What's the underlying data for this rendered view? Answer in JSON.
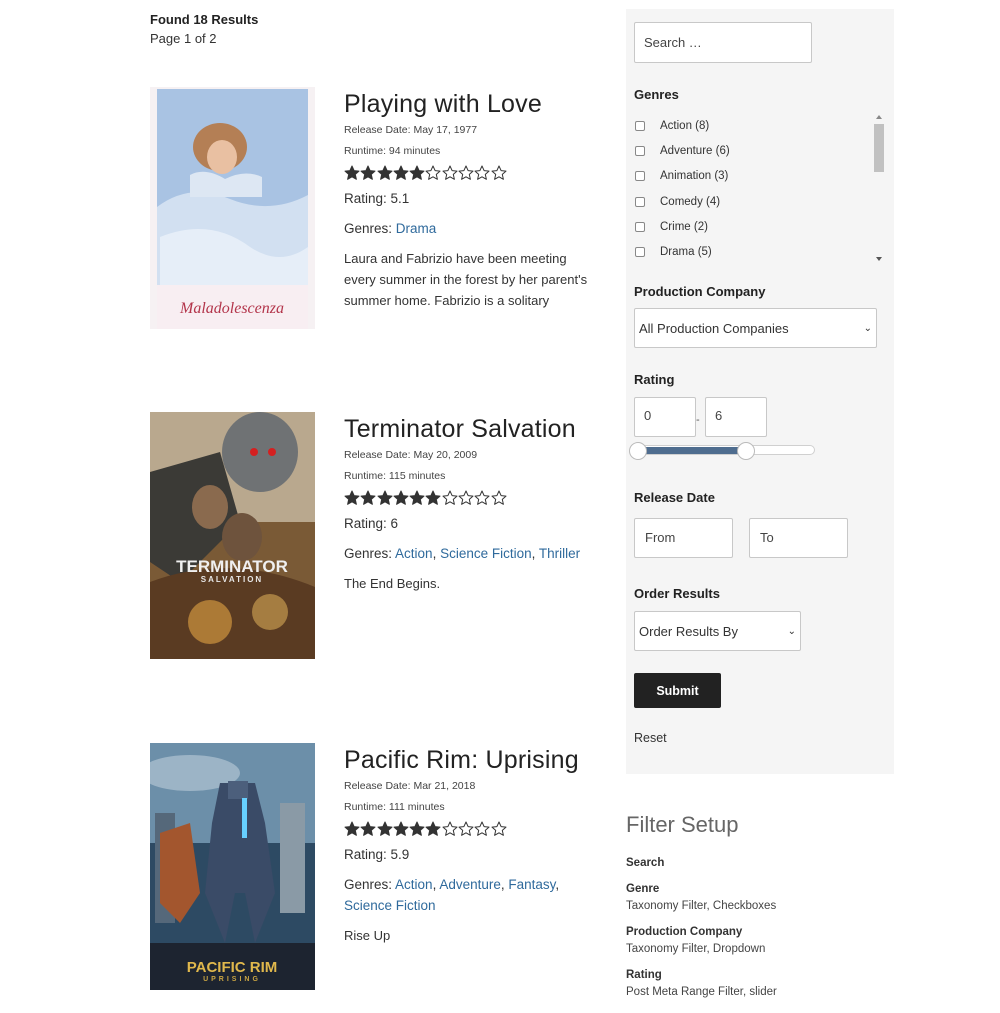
{
  "results": {
    "found": "Found 18 Results",
    "page": "Page 1 of 2"
  },
  "movies": [
    {
      "title": "Playing with Love",
      "release": "Release Date: May 17, 1977",
      "runtime": "Runtime: 94 minutes",
      "rating_value": 5.1,
      "rating": "Rating: 5.1",
      "genres_label": "Genres:",
      "genres": [
        "Drama"
      ],
      "description": "Laura and Fabrizio have been meeting every summer in the forest by her parent's summer home. Fabrizio is a solitary",
      "poster_text": "Maladolescenza"
    },
    {
      "title": "Terminator Salvation",
      "release": "Release Date: May 20, 2009",
      "runtime": "Runtime: 115 minutes",
      "rating_value": 6,
      "rating": "Rating: 6",
      "genres_label": "Genres:",
      "genres": [
        "Action",
        "Science Fiction",
        "Thriller"
      ],
      "description": "The End Begins.",
      "poster_text": "TERMINATOR",
      "poster_subtext": "SALVATION"
    },
    {
      "title": "Pacific Rim: Uprising",
      "release": "Release Date: Mar 21, 2018",
      "runtime": "Runtime: 111 minutes",
      "rating_value": 5.9,
      "rating": "Rating: 5.9",
      "genres_label": "Genres:",
      "genres": [
        "Action",
        "Adventure",
        "Fantasy",
        "Science Fiction"
      ],
      "description": "Rise Up",
      "poster_text": "PACIFIC RIM",
      "poster_subtext": "UPRISING"
    }
  ],
  "sidebar": {
    "search_placeholder": "Search …",
    "genres_label": "Genres",
    "genres": [
      "Action (8)",
      "Adventure (6)",
      "Animation (3)",
      "Comedy (4)",
      "Crime (2)",
      "Drama (5)"
    ],
    "company_label": "Production Company",
    "company_value": "All Production Companies",
    "rating_label": "Rating",
    "rating_min": "0",
    "rating_max": "6",
    "rating_dash": "-",
    "release_label": "Release Date",
    "from": "From",
    "to": "To",
    "order_label": "Order Results",
    "order_value": "Order Results By",
    "submit": "Submit",
    "reset": "Reset"
  },
  "filter_setup": {
    "title": "Filter Setup",
    "items": [
      {
        "label": "Search",
        "desc": ""
      },
      {
        "label": "Genre",
        "desc": "Taxonomy Filter, Checkboxes"
      },
      {
        "label": "Production Company",
        "desc": "Taxonomy Filter, Dropdown"
      },
      {
        "label": "Rating",
        "desc": "Post Meta Range Filter, slider"
      }
    ]
  },
  "colors": {
    "link": "#2f6a9c",
    "sidebar_bg": "#f5f5f5",
    "button": "#222222",
    "slider": "#4f6d8f"
  }
}
